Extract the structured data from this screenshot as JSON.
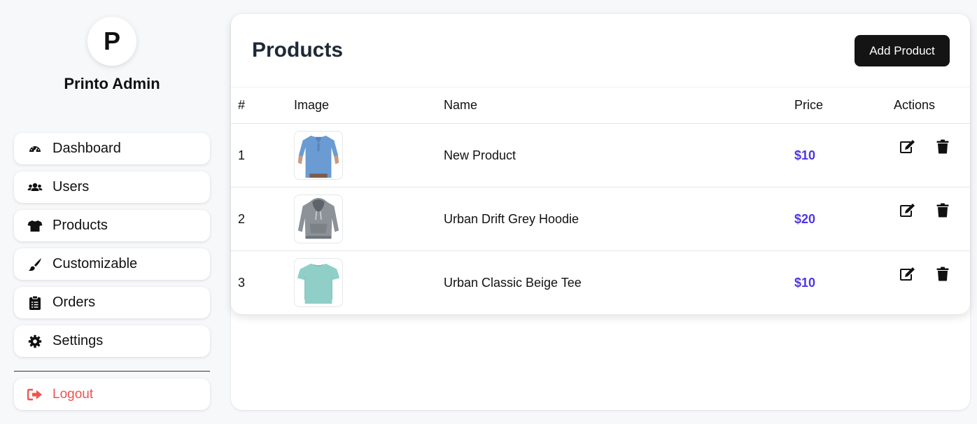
{
  "sidebar": {
    "avatar_letter": "P",
    "brand": "Printo Admin",
    "items": [
      {
        "label": "Dashboard",
        "icon": "gauge-icon"
      },
      {
        "label": "Users",
        "icon": "users-icon"
      },
      {
        "label": "Products",
        "icon": "tshirt-icon"
      },
      {
        "label": "Customizable",
        "icon": "brush-icon"
      },
      {
        "label": "Orders",
        "icon": "clipboard-list-icon"
      },
      {
        "label": "Settings",
        "icon": "gear-icon"
      }
    ],
    "logout": {
      "label": "Logout",
      "icon": "sign-out-icon"
    }
  },
  "main": {
    "title": "Products",
    "add_button": "Add Product",
    "columns": [
      "#",
      "Image",
      "Name",
      "Price",
      "Actions"
    ],
    "rows": [
      {
        "num": "1",
        "name": "New Product",
        "price": "$10",
        "image": "blue polo shirt"
      },
      {
        "num": "2",
        "name": "Urban Drift Grey Hoodie",
        "price": "$20",
        "image": "grey hoodie"
      },
      {
        "num": "3",
        "name": "Urban Classic Beige Tee",
        "price": "$10",
        "image": "mint tee"
      }
    ]
  },
  "colors": {
    "accent_price": "#4f35e8",
    "logout": "#ef5350",
    "button_dark": "#141414",
    "background": "#f7f8fa"
  }
}
